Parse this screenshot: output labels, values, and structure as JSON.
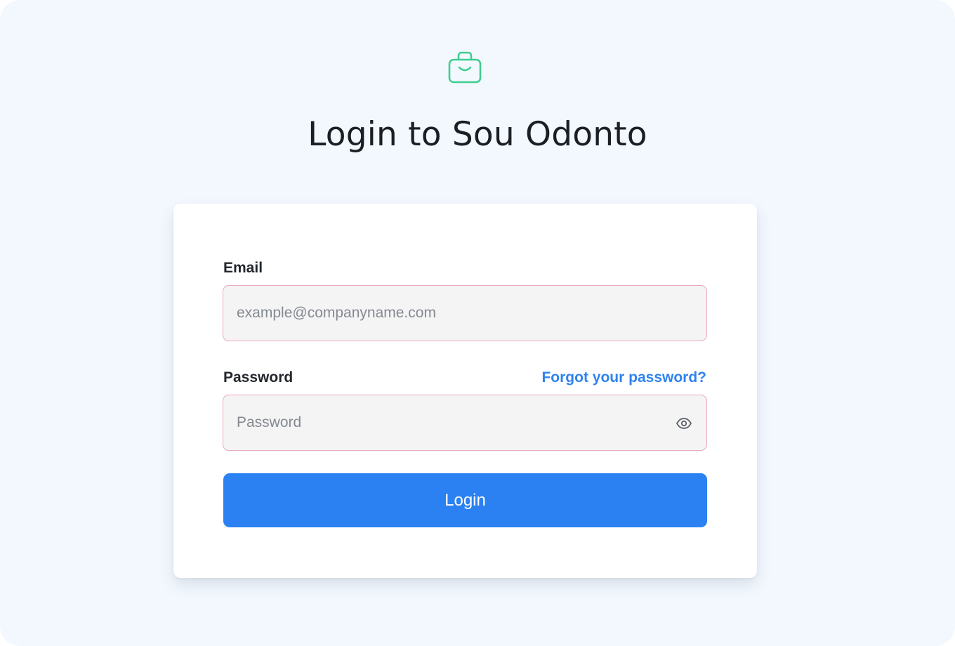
{
  "page": {
    "title": "Login to Sou Odonto",
    "logo_icon": "briefcase-smile-icon",
    "background_color": "#f3f8fe"
  },
  "form": {
    "email": {
      "label": "Email",
      "placeholder": "example@companyname.com",
      "value": ""
    },
    "password": {
      "label": "Password",
      "placeholder": "Password",
      "value": "",
      "toggle_icon": "eye-icon"
    },
    "forgot_link": "Forgot your password?",
    "submit_label": "Login"
  },
  "colors": {
    "accent": "#2b81f2",
    "logo": "#3ecf8e",
    "input_border": "#e9a9b8",
    "input_background": "#f4f4f5"
  }
}
